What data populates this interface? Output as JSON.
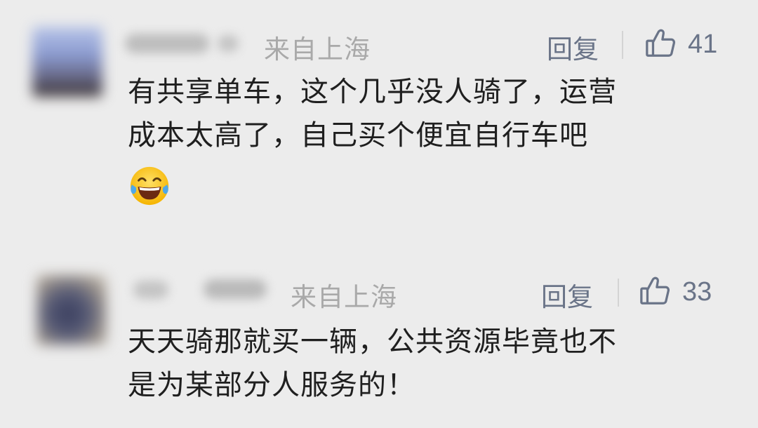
{
  "comments": [
    {
      "location": "来自上海",
      "reply_label": "回复",
      "like_count": "41",
      "text_line1": "有共享单车，这个几乎没人骑了，运营",
      "text_line2": "成本太高了，自己买个便宜自行车吧",
      "emoji_name": "laughing-tears-icon"
    },
    {
      "location": "来自上海",
      "reply_label": "回复",
      "like_count": "33",
      "text_line1": "天天骑那就买一辆，公共资源毕竟也不",
      "text_line2": "是为某部分人服务的！"
    }
  ],
  "colors": {
    "background": "#ececec",
    "meta_gray": "#a9a9a9",
    "action_blue_gray": "#6a7488",
    "body_text": "#1f1f1f"
  }
}
